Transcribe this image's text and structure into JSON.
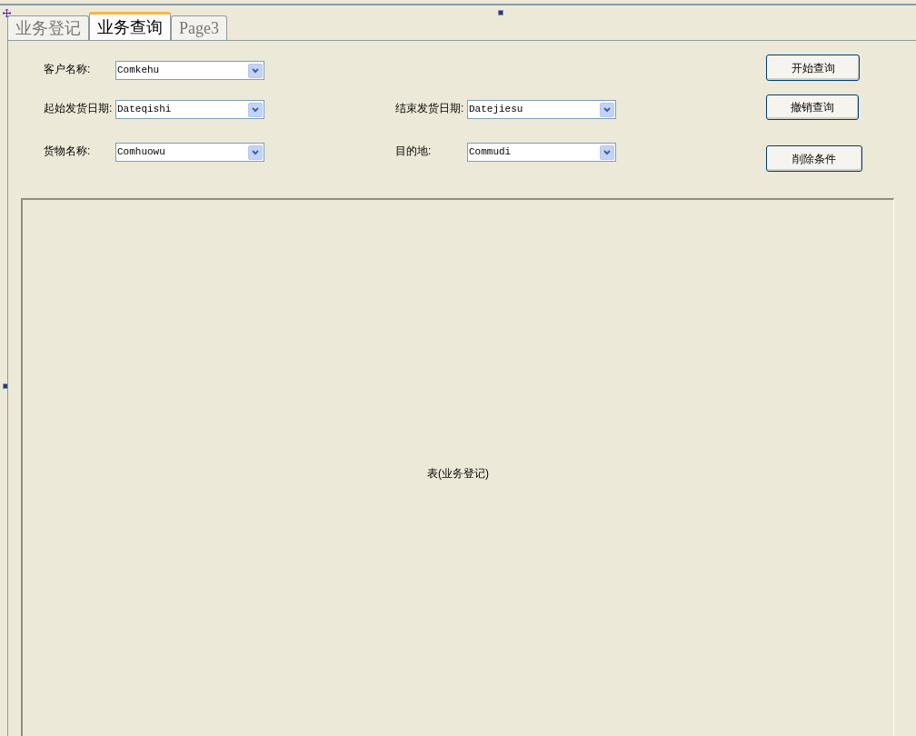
{
  "tabs": [
    {
      "label": "业务登记",
      "selected": false
    },
    {
      "label": "业务查询",
      "selected": true
    },
    {
      "label": "Page3",
      "selected": false
    }
  ],
  "field_rows": [
    [
      {
        "label": "客户名称:",
        "value": "Comkehu"
      }
    ],
    [
      {
        "label": "起始发货日期:",
        "value": "Dateqishi"
      },
      {
        "label": "结束发货日期:",
        "value": "Datejiesu"
      }
    ],
    [
      {
        "label": "货物名称:",
        "value": "Comhuowu"
      },
      {
        "label": "目的地:",
        "value": "Commudi"
      }
    ]
  ],
  "buttons": [
    "开始查询",
    "撤销查询",
    "削除条件"
  ],
  "subform": {
    "label": "表(业务登记)"
  }
}
